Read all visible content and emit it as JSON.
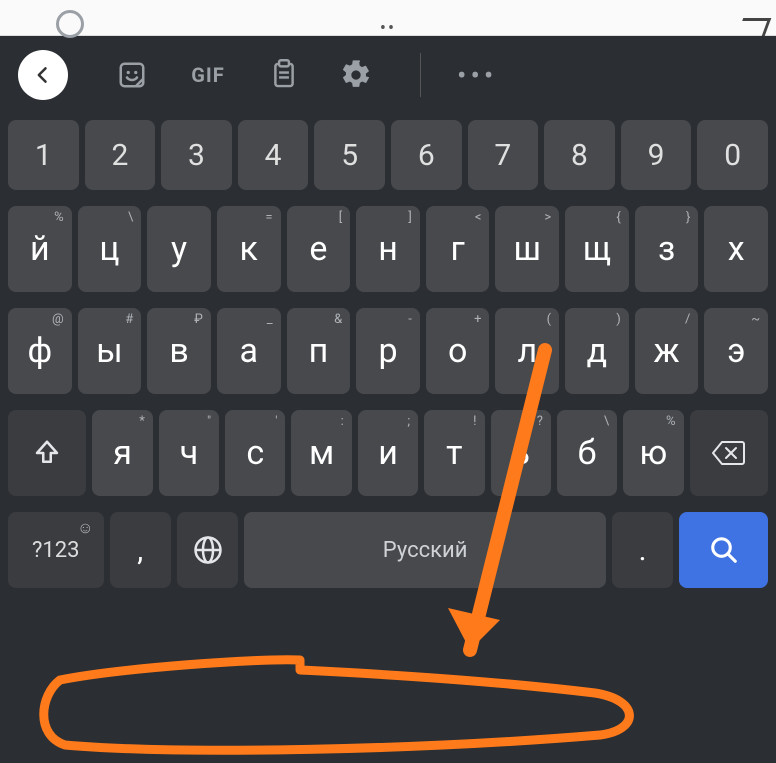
{
  "toolbar": {
    "gif": "GIF"
  },
  "rows": {
    "num": [
      "1",
      "2",
      "3",
      "4",
      "5",
      "6",
      "7",
      "8",
      "9",
      "0"
    ],
    "r1": {
      "main": [
        "й",
        "ц",
        "у",
        "к",
        "е",
        "н",
        "г",
        "ш",
        "щ",
        "з",
        "х"
      ],
      "hint": [
        "%",
        "\\",
        "",
        "=",
        "[",
        "]",
        "<",
        ">",
        "{",
        "}",
        ""
      ]
    },
    "r2": {
      "main": [
        "ф",
        "ы",
        "в",
        "а",
        "п",
        "р",
        "о",
        "л",
        "д",
        "ж",
        "э"
      ],
      "hint": [
        "@",
        "#",
        "₽",
        "_",
        "&",
        "-",
        "+",
        "(",
        ")",
        "/",
        "~"
      ]
    },
    "r3": {
      "main": [
        "я",
        "ч",
        "с",
        "м",
        "и",
        "т",
        "ь",
        "б",
        "ю"
      ],
      "hint": [
        "*",
        "\"",
        "'",
        ":",
        ";",
        "!",
        "?",
        "\\",
        "%"
      ]
    }
  },
  "bottom": {
    "sym": "?123",
    "sym_hint": "☺",
    "comma": ",",
    "space": "Русский",
    "dot": "."
  }
}
